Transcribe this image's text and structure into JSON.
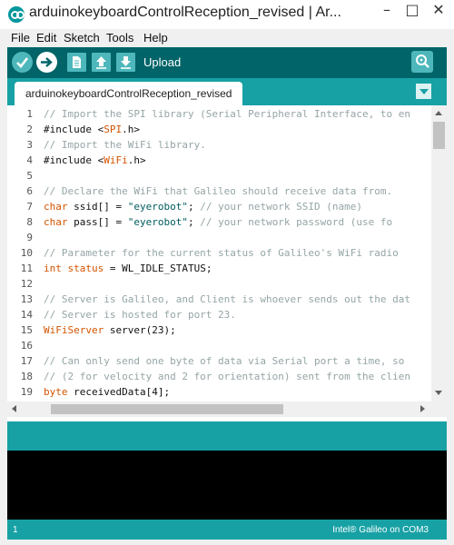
{
  "window": {
    "title": "arduinokeyboardControlReception_revised | Ar...",
    "min_glyph": "–",
    "max_glyph": "□",
    "close_glyph": "✕"
  },
  "menu": [
    "File",
    "Edit",
    "Sketch",
    "Tools",
    "Help"
  ],
  "toolbar": {
    "hover_label": "Upload",
    "buttons": [
      "verify-icon",
      "upload-icon",
      "new-icon",
      "open-icon",
      "save-icon"
    ],
    "serial_monitor": "serial-monitor-icon"
  },
  "tab": {
    "label": "arduinokeyboardControlReception_revised"
  },
  "editor": {
    "lines": [
      {
        "n": "1",
        "segs": [
          {
            "c": "cm",
            "t": "// Import the SPI library (Serial Peripheral Interface, to en"
          }
        ]
      },
      {
        "n": "2",
        "segs": [
          {
            "c": "pl",
            "t": "#include <"
          },
          {
            "c": "kw",
            "t": "SPI"
          },
          {
            "c": "pl",
            "t": ".h>"
          }
        ]
      },
      {
        "n": "3",
        "segs": [
          {
            "c": "cm",
            "t": "// Import the WiFi library."
          }
        ]
      },
      {
        "n": "4",
        "segs": [
          {
            "c": "pl",
            "t": "#include <"
          },
          {
            "c": "kw",
            "t": "WiFi"
          },
          {
            "c": "pl",
            "t": ".h>"
          }
        ]
      },
      {
        "n": "5",
        "segs": []
      },
      {
        "n": "6",
        "segs": [
          {
            "c": "cm",
            "t": "// Declare the WiFi that Galileo should receive data from."
          }
        ]
      },
      {
        "n": "7",
        "segs": [
          {
            "c": "kw",
            "t": "char"
          },
          {
            "c": "pl",
            "t": " ssid[] = "
          },
          {
            "c": "st",
            "t": "\"eyerobot\""
          },
          {
            "c": "pl",
            "t": "; "
          },
          {
            "c": "cm",
            "t": "//  your network SSID (name)"
          }
        ]
      },
      {
        "n": "8",
        "segs": [
          {
            "c": "kw",
            "t": "char"
          },
          {
            "c": "pl",
            "t": " pass[] = "
          },
          {
            "c": "st",
            "t": "\"eyerobot\""
          },
          {
            "c": "pl",
            "t": ";    "
          },
          {
            "c": "cm",
            "t": "// your network password (use fo"
          }
        ]
      },
      {
        "n": "9",
        "segs": []
      },
      {
        "n": "10",
        "segs": [
          {
            "c": "cm",
            "t": "// Parameter for the current status of Galileo's WiFi radio"
          }
        ]
      },
      {
        "n": "11",
        "segs": [
          {
            "c": "kw",
            "t": "int"
          },
          {
            "c": "pl",
            "t": " "
          },
          {
            "c": "fn",
            "t": "status"
          },
          {
            "c": "pl",
            "t": " = WL_IDLE_STATUS;"
          }
        ]
      },
      {
        "n": "12",
        "segs": []
      },
      {
        "n": "13",
        "segs": [
          {
            "c": "cm",
            "t": "// Server is Galileo, and Client is whoever sends out the dat"
          }
        ]
      },
      {
        "n": "14",
        "segs": [
          {
            "c": "cm",
            "t": "// Server is hosted for port 23."
          }
        ]
      },
      {
        "n": "15",
        "segs": [
          {
            "c": "kw",
            "t": "WiFiServer"
          },
          {
            "c": "pl",
            "t": " server(23);"
          }
        ]
      },
      {
        "n": "16",
        "segs": []
      },
      {
        "n": "17",
        "segs": [
          {
            "c": "cm",
            "t": "// Can only send one byte of data via Serial port a time, so"
          }
        ]
      },
      {
        "n": "18",
        "segs": [
          {
            "c": "cm",
            "t": "// (2 for velocity and 2 for orientation) sent from the clien"
          }
        ]
      },
      {
        "n": "19",
        "segs": [
          {
            "c": "kw",
            "t": "byte"
          },
          {
            "c": "pl",
            "t": " receivedData[4];"
          }
        ]
      }
    ]
  },
  "status": {
    "line_number": "1",
    "board": "Intel® Galileo on COM3"
  }
}
